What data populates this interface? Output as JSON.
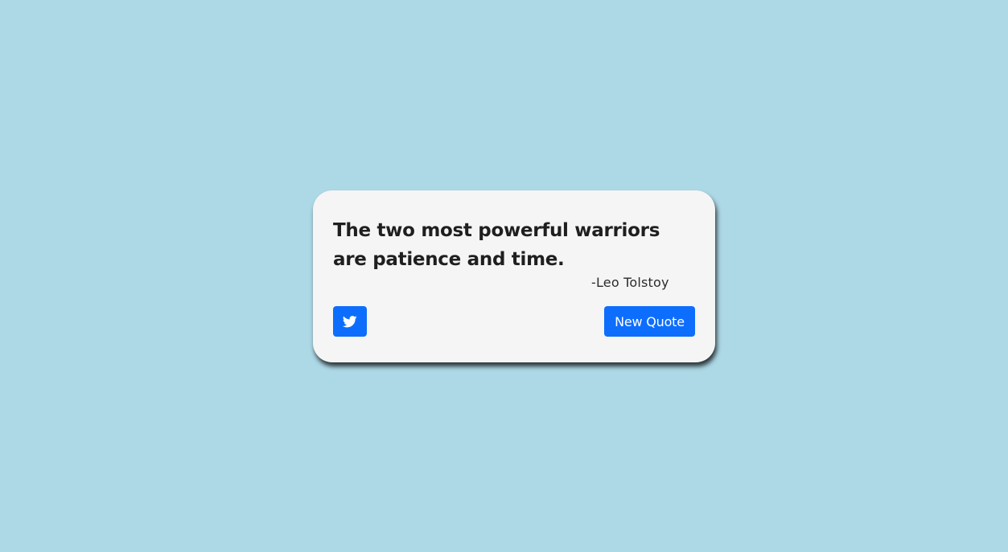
{
  "colors": {
    "background": "#add8e6",
    "card": "#f5f5f5",
    "accent": "#0d6efd",
    "text": "#1f1f1f"
  },
  "quote": {
    "text": "The two most powerful warriors are patience and time.",
    "author": "-Leo Tolstoy"
  },
  "actions": {
    "tweet_icon": "twitter-icon",
    "new_quote_label": "New Quote"
  }
}
